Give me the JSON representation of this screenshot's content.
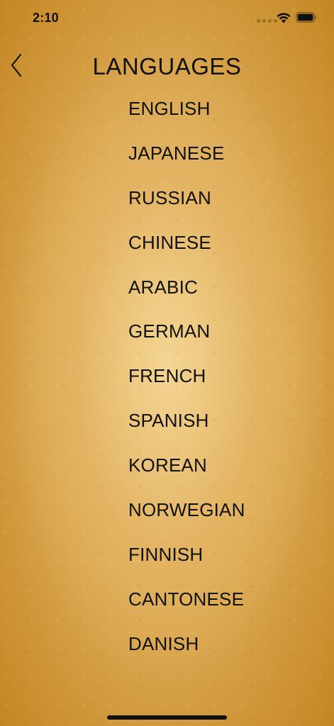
{
  "status_bar": {
    "time": "2:10",
    "icons": [
      "signal-dots-icon",
      "wifi-icon",
      "battery-icon"
    ]
  },
  "nav": {
    "back_icon": "chevron-left-icon",
    "title": "LANGUAGES"
  },
  "languages": [
    "ENGLISH",
    "JAPANESE",
    "RUSSIAN",
    "CHINESE",
    "ARABIC",
    "GERMAN",
    "FRENCH",
    "SPANISH",
    "KOREAN",
    "NORWEGIAN",
    "FINNISH",
    "CANTONESE",
    "DANISH"
  ],
  "colors": {
    "background_center": "#e8bf74",
    "background_edge": "#c48623",
    "text": "#111111"
  }
}
